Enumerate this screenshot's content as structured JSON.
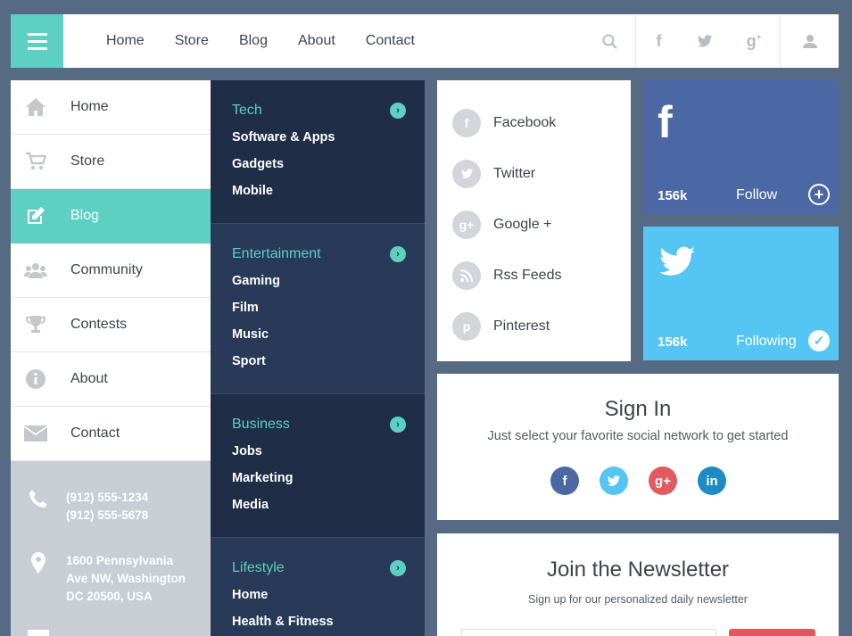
{
  "colors": {
    "accent": "#5dcfc3",
    "navy": "#1f2d47",
    "facebook": "#4b68a5",
    "twitter": "#55c5f4",
    "google": "#e05a5f",
    "linkedin": "#1f8bc5",
    "background": "#566a83"
  },
  "topnav": {
    "menu_icon": "hamburger-icon",
    "links": [
      "Home",
      "Store",
      "Blog",
      "About",
      "Contact"
    ],
    "icons": [
      "search-icon",
      "facebook-icon",
      "twitter-icon",
      "google-plus-icon",
      "user-icon"
    ]
  },
  "leftmenu": {
    "items": [
      {
        "label": "Home",
        "icon": "home-icon"
      },
      {
        "label": "Store",
        "icon": "cart-icon"
      },
      {
        "label": "Blog",
        "icon": "edit-icon",
        "active": true
      },
      {
        "label": "Community",
        "icon": "users-icon"
      },
      {
        "label": "Contests",
        "icon": "trophy-icon"
      },
      {
        "label": "About",
        "icon": "info-icon"
      },
      {
        "label": "Contact",
        "icon": "mail-icon"
      }
    ],
    "phone1": "(912) 555-1234",
    "phone2": "(912) 555-5678",
    "address1": "1600 Pennsylvania",
    "address2": "Ave NW, Washington",
    "address3": "DC 20500, USA"
  },
  "categories": [
    {
      "title": "Tech",
      "items": [
        "Software & Apps",
        "Gadgets",
        "Mobile"
      ]
    },
    {
      "title": "Entertainment",
      "items": [
        "Gaming",
        "Film",
        "Music",
        "Sport"
      ]
    },
    {
      "title": "Business",
      "items": [
        "Jobs",
        "Marketing",
        "Media"
      ]
    },
    {
      "title": "Lifestyle",
      "items": [
        "Home",
        "Health & Fitness"
      ]
    }
  ],
  "social_list": [
    {
      "label": "Facebook",
      "glyph": "f",
      "icon": "facebook-icon"
    },
    {
      "label": "Twitter",
      "glyph": "t",
      "icon": "twitter-icon"
    },
    {
      "label": "Google +",
      "glyph": "g+",
      "icon": "google-plus-icon"
    },
    {
      "label": "Rss Feeds",
      "glyph": "))",
      "icon": "rss-icon"
    },
    {
      "label": "Pinterest",
      "glyph": "p",
      "icon": "pinterest-icon"
    }
  ],
  "tiles": {
    "facebook": {
      "logo": "f",
      "count": "156k",
      "action": "Follow"
    },
    "twitter": {
      "logo": "t",
      "count": "156k",
      "action": "Following"
    }
  },
  "signin": {
    "title": "Sign In",
    "subtitle": "Just select your favorite social network to get started",
    "networks": [
      {
        "glyph": "f",
        "icon": "facebook-icon"
      },
      {
        "glyph": "t",
        "icon": "twitter-icon"
      },
      {
        "glyph": "g+",
        "icon": "google-plus-icon"
      },
      {
        "glyph": "in",
        "icon": "linkedin-icon"
      }
    ]
  },
  "newsletter": {
    "title": "Join the Newsletter",
    "subtitle": "Sign up for our personalized daily newsletter"
  }
}
